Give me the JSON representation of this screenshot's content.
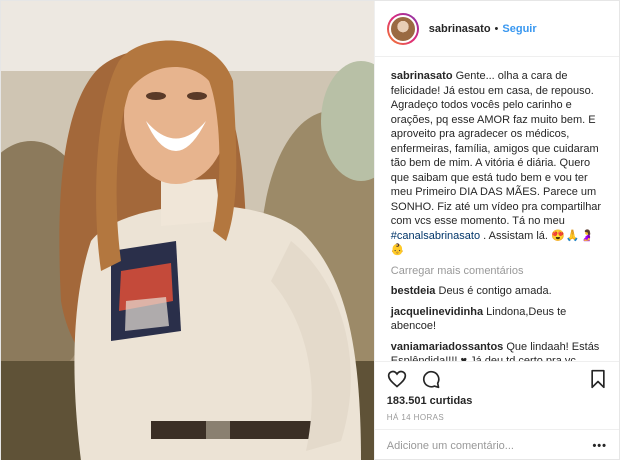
{
  "header": {
    "username": "sabrinasato",
    "separator": "•",
    "follow_label": "Seguir"
  },
  "caption": {
    "username": "sabrinasato",
    "text": "Gente... olha a cara de felicidade! Já estou em casa, de repouso. Agradeço todos vocês pelo carinho e orações, pq esse AMOR faz muito bem. E aproveito pra agradecer os médicos, enfermeiras, família, amigos que cuidaram tão bem de mim. A vitória é diária. Quero que saibam que está tudo bem e vou ter meu Primeiro DIA DAS MÃES. Parece um SONHO. Fiz até um vídeo pra compartilhar com vcs esse momento. Tá no meu",
    "hashtag": "#canalsabrinasato",
    "text_after": ". Assistam lá.",
    "emojis": "😍🙏🤰👶"
  },
  "load_more": "Carregar mais comentários",
  "comments": [
    {
      "username": "bestdeia",
      "text": "Deus é contigo amada."
    },
    {
      "username": "jacquelinevidinha",
      "text": "Lindona,Deus te abencoe!"
    },
    {
      "username": "vaniamariadossantos",
      "text": "Que lindaah! Estás Esplêndida!!!! ♥ Já deu td certo pra vc, querida!! Deus está cuidando de TI e da tua"
    }
  ],
  "likes": "183.501 curtidas",
  "timestamp": "HÁ 14 HORAS",
  "add_comment_placeholder": "Adicione um comentário...",
  "more_options": "•••",
  "icons": {
    "like": "heart-icon",
    "comment": "comment-icon",
    "save": "bookmark-icon"
  },
  "colors": {
    "follow": "#3897f0",
    "muted": "#999999",
    "text": "#262626"
  }
}
